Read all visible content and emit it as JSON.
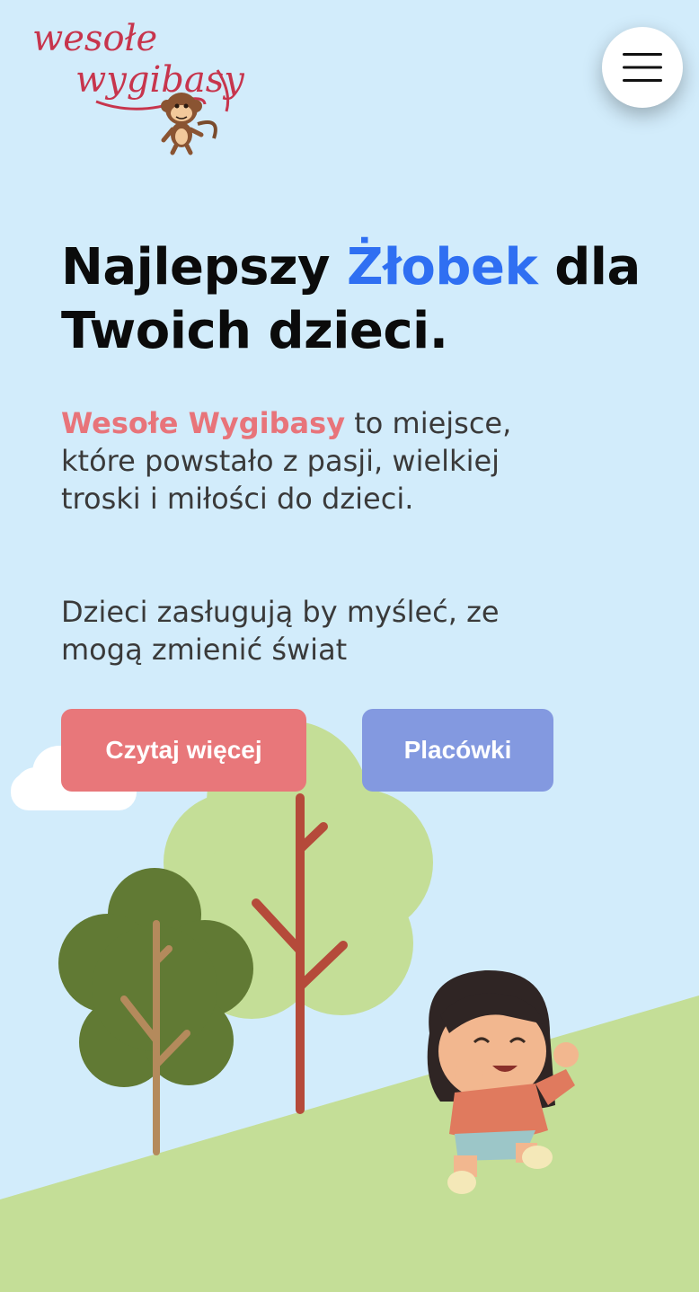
{
  "header": {
    "logo_line1": "wesołe",
    "logo_line2": "wygibasy",
    "menu_icon": "hamburger-menu-icon"
  },
  "hero": {
    "title_part1": "Najlepszy ",
    "title_accent": "Żłobek",
    "title_part2": " dla Twoich dzieci.",
    "intro_brand": "Wesołe Wygibasy",
    "intro_text": " to miejsce, które powstało z pasji, wielkiej troski i miłości do dzieci.",
    "tagline": "Dzieci zasługują by myśleć, ze mogą zmienić świat"
  },
  "buttons": {
    "read_more": "Czytaj więcej",
    "locations": "Placówki"
  },
  "colors": {
    "background": "#d2ecfb",
    "accent_blue": "#2f6ff2",
    "brand_pink": "#e8747a",
    "button_primary": "#e8777a",
    "button_secondary": "#8399e0",
    "hill_green": "#c4de97"
  }
}
